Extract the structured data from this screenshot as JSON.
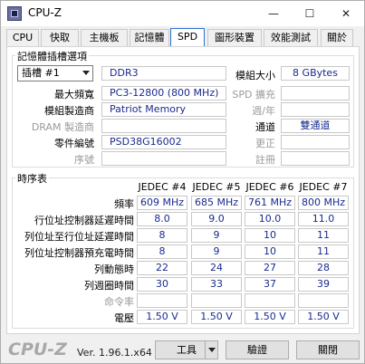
{
  "window": {
    "title": "CPU-Z",
    "minimize": "—",
    "maximize": "☐",
    "close": "✕"
  },
  "tabs": [
    {
      "label": "CPU"
    },
    {
      "label": "快取"
    },
    {
      "label": "主機板"
    },
    {
      "label": "記憶體"
    },
    {
      "label": "SPD"
    },
    {
      "label": "圖形裝置"
    },
    {
      "label": "效能測試"
    },
    {
      "label": "關於"
    }
  ],
  "slot_group": {
    "title": "記憶體插槽選項",
    "slot_select": "插槽 #1",
    "type": "DDR3",
    "max_bandwidth_label": "最大頻寬",
    "max_bandwidth": "PC3-12800 (800 MHz)",
    "manufacturer_label": "模組製造商",
    "manufacturer": "Patriot Memory",
    "dram_mfr_label": "DRAM 製造商",
    "dram_mfr": "",
    "part_number_label": "零件編號",
    "part_number": "PSD38G16002",
    "serial_label": "序號",
    "serial": "",
    "module_size_label": "模組大小",
    "module_size": "8 GBytes",
    "spd_ext_label": "SPD 擴充",
    "spd_ext": "",
    "week_year_label": "週/年",
    "week_year": "",
    "channels_label": "通道",
    "channels": "雙通道",
    "correction_label": "更正",
    "correction": "",
    "registered_label": "註冊",
    "registered": ""
  },
  "timings": {
    "title": "時序表",
    "columns": [
      "JEDEC #4",
      "JEDEC #5",
      "JEDEC #6",
      "JEDEC #7"
    ],
    "rows": [
      {
        "label": "頻率",
        "dim": false,
        "values": [
          "609 MHz",
          "685 MHz",
          "761 MHz",
          "800 MHz"
        ]
      },
      {
        "label": "行位址控制器延遲時間",
        "dim": false,
        "values": [
          "8.0",
          "9.0",
          "10.0",
          "11.0"
        ]
      },
      {
        "label": "列位址至行位址延遲時間",
        "dim": false,
        "values": [
          "8",
          "9",
          "10",
          "11"
        ]
      },
      {
        "label": "列位址控制器預充電時間",
        "dim": false,
        "values": [
          "8",
          "9",
          "10",
          "11"
        ]
      },
      {
        "label": "列動態時",
        "dim": false,
        "values": [
          "22",
          "24",
          "27",
          "28"
        ]
      },
      {
        "label": "列週圈時間",
        "dim": false,
        "values": [
          "30",
          "33",
          "37",
          "39"
        ]
      },
      {
        "label": "命令率",
        "dim": true,
        "values": [
          "",
          "",
          "",
          ""
        ]
      },
      {
        "label": "電壓",
        "dim": false,
        "values": [
          "1.50 V",
          "1.50 V",
          "1.50 V",
          "1.50 V"
        ]
      }
    ]
  },
  "footer": {
    "logo": "CPU-Z",
    "version": "Ver. 1.96.1.x64",
    "tools_label": "工具",
    "validate_label": "驗證",
    "close_label": "關閉"
  }
}
